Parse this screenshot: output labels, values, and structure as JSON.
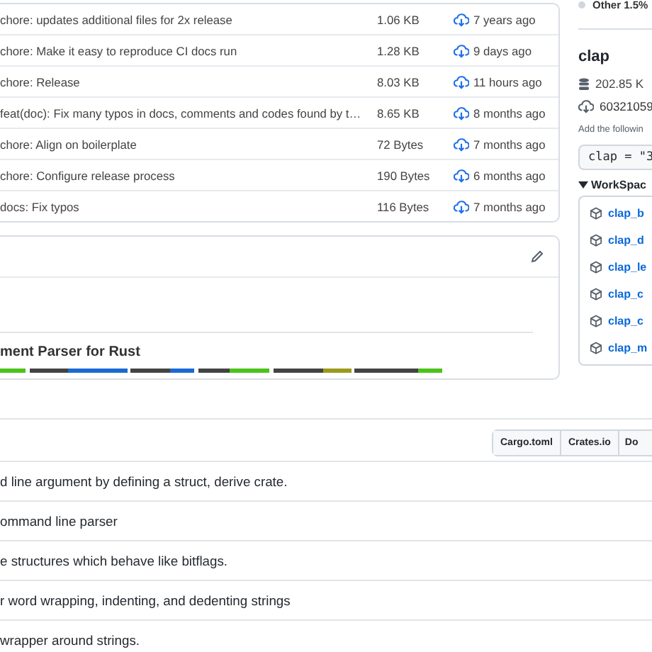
{
  "files": [
    {
      "message": "chore: updates additional files for 2x release",
      "size": "1.06 KB",
      "age": "7 years ago"
    },
    {
      "message": "chore: Make it easy to reproduce CI docs run",
      "size": "1.28 KB",
      "age": "9 days ago"
    },
    {
      "message": "chore: Release",
      "size": "8.03 KB",
      "age": "11 hours ago"
    },
    {
      "message": "feat(doc): Fix many typos in docs, comments and codes found by t…",
      "size": "8.65 KB",
      "age": "8 months ago"
    },
    {
      "message": "chore: Align on boilerplate",
      "size": "72 Bytes",
      "age": "7 months ago"
    },
    {
      "message": "chore: Configure release process",
      "size": "190 Bytes",
      "age": "6 months ago"
    },
    {
      "message": "docs: Fix typos",
      "size": "116 Bytes",
      "age": "7 months ago"
    }
  ],
  "readme": {
    "subtitle": "ment Parser for Rust"
  },
  "languages": {
    "other": "Other 1.5%"
  },
  "crate": {
    "name": "clap",
    "size": "202.85 K",
    "downloads": "60321059",
    "install_hint": "Add the followin",
    "install_code": "clap = \"3",
    "workspace_title": "WorkSpac",
    "workspace_expanded": true,
    "members": [
      "clap_b",
      "clap_d",
      "clap_le",
      "clap_c",
      "clap_c",
      "clap_m"
    ]
  },
  "links": [
    "Cargo.toml",
    "Crates.io",
    "Do"
  ],
  "dependencies": [
    {
      "description": "d line argument by defining a struct, derive crate."
    },
    {
      "description": "ommand line parser"
    },
    {
      "description": "e structures which behave like bitflags."
    },
    {
      "description": "r word wrapping, indenting, and dedenting strings"
    },
    {
      "description": "wrapper around strings."
    }
  ]
}
